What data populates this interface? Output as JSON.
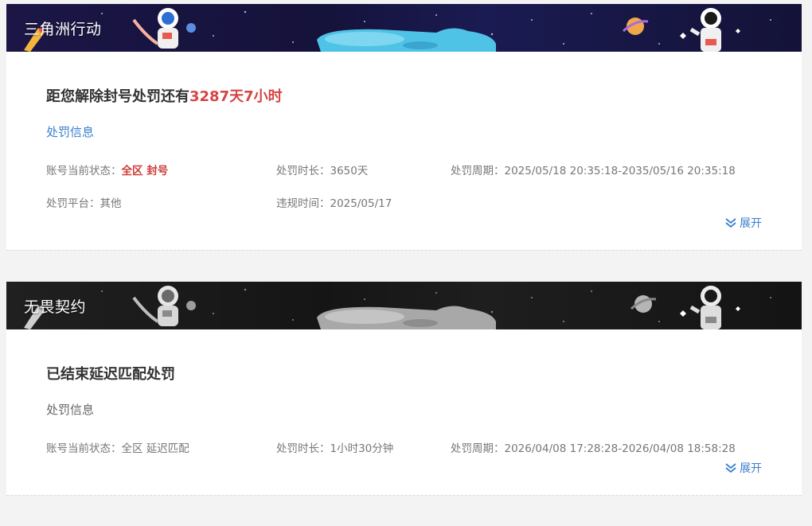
{
  "cards": [
    {
      "game_title": "三角洲行动",
      "headline_prefix": "距您解除封号处罚还有",
      "headline_highlight": "3287天7小时",
      "section_label": "处罚信息",
      "fields": {
        "status_label": "账号当前状态：",
        "status_value": "全区 封号",
        "duration_label": "处罚时长：",
        "duration_value": "3650天",
        "period_label": "处罚周期：",
        "period_value": "2025/05/18 20:35:18-2035/05/16 20:35:18",
        "platform_label": "处罚平台：",
        "platform_value": "其他",
        "violation_label": "违规时间：",
        "violation_value": "2025/05/17"
      },
      "expand_label": "展开",
      "accent": "#d64545"
    },
    {
      "game_title": "无畏契约",
      "headline": "已结束延迟匹配处罚",
      "section_label": "处罚信息",
      "fields": {
        "status_label": "账号当前状态：",
        "status_value": "全区 延迟匹配",
        "duration_label": "处罚时长：",
        "duration_value": "1小时30分钟",
        "period_label": "处罚周期：",
        "period_value": "2026/04/08 17:28:28-2026/04/08 18:58:28"
      },
      "expand_label": "展开"
    }
  ],
  "icons": {
    "expand": "double-chevron-down-icon"
  },
  "colors": {
    "link_blue": "#3a7fd0",
    "alert_red": "#d64545",
    "banner_active": "#1b1646",
    "banner_ended": "#1a1a1a"
  }
}
